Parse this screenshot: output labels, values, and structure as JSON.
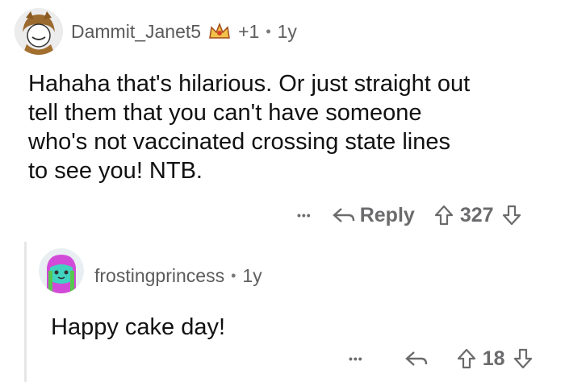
{
  "comment": {
    "username": "Dammit_Janet5",
    "karma_badge": "+1",
    "separator": "•",
    "age": "1y",
    "body": "Hahaha that's hilarious. Or just straight out\ntell them that you can't have someone\nwho's not vaccinated crossing state lines\nto see you! NTB.",
    "more_label": "•••",
    "reply_label": "Reply",
    "score": "327",
    "icons": {
      "avatar": "avatar-icon",
      "badge": "award-crown-icon",
      "reply": "reply-arrow-icon",
      "upvote": "upvote-arrow-icon",
      "downvote": "downvote-arrow-icon"
    }
  },
  "reply": {
    "username": "frostingprincess",
    "separator": "•",
    "age": "1y",
    "body": "Happy cake day!",
    "more_label": "•••",
    "score": "18"
  },
  "colors": {
    "accent_text": "#5f5f60",
    "body_text": "#111111",
    "thread_line": "#e6e6e8"
  }
}
